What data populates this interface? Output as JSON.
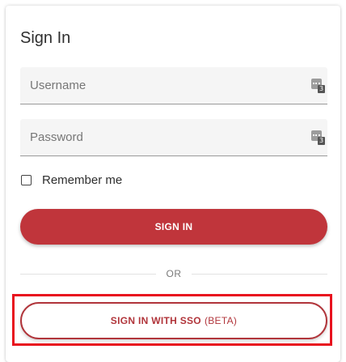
{
  "form": {
    "title": "Sign In",
    "username": {
      "placeholder": "Username",
      "value": "",
      "manager_badge": "3"
    },
    "password": {
      "placeholder": "Password",
      "value": "",
      "manager_badge": "3"
    },
    "remember_label": "Remember me",
    "remember_checked": false,
    "signin_label": "SIGN IN",
    "divider_label": "OR",
    "sso_label": "SIGN IN WITH SSO",
    "sso_suffix": "(BETA)"
  },
  "colors": {
    "accent": "#c0353b",
    "highlight": "#e8121e"
  },
  "icons": {
    "password_manager": "password-manager-icon"
  }
}
